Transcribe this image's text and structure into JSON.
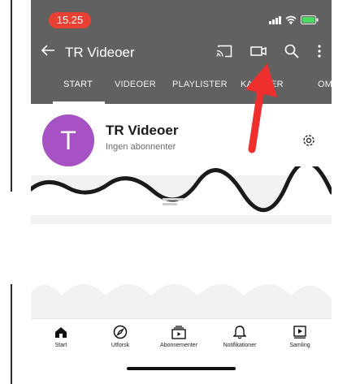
{
  "status_bar": {
    "time": "15.25",
    "time_pill_color": "#e84133",
    "battery_color": "#4cd964",
    "icons": [
      "signal-icon",
      "wifi-icon",
      "battery-icon"
    ]
  },
  "app_bar": {
    "title": "TR Videoer",
    "background": "#616161",
    "icons": [
      "back-arrow-icon",
      "cast-icon",
      "camera-icon",
      "search-icon",
      "more-vert-icon"
    ]
  },
  "tabs": [
    {
      "label": "START",
      "selected": true
    },
    {
      "label": "VIDEOER",
      "selected": false
    },
    {
      "label": "PLAYLISTER",
      "selected": false
    },
    {
      "label": "KANALER",
      "selected": false
    },
    {
      "label": "OM",
      "selected": false
    }
  ],
  "channel": {
    "avatar_letter": "T",
    "avatar_color": "#a651c4",
    "name": "TR Videoer",
    "subscribers": "Ingen abonnenter"
  },
  "annotation": {
    "arrow_color": "#ef2e2e",
    "points_to": "camera-icon"
  },
  "bottom_nav": [
    {
      "label": "Start",
      "icon": "home-icon"
    },
    {
      "label": "Utforsk",
      "icon": "explore-icon"
    },
    {
      "label": "Abonnementer",
      "icon": "subscriptions-icon"
    },
    {
      "label": "Notifikationer",
      "icon": "bell-icon"
    },
    {
      "label": "Samling",
      "icon": "library-icon"
    }
  ]
}
